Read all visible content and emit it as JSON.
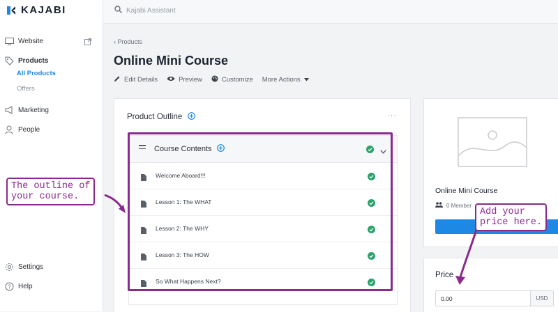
{
  "app": {
    "logo_text": "KAJABI"
  },
  "search": {
    "placeholder": "Kajabi Assistant"
  },
  "sidebar": {
    "items": [
      {
        "label": "Website",
        "icon": "monitor-icon"
      },
      {
        "label": "Products",
        "icon": "tag-icon"
      },
      {
        "label": "All Products"
      },
      {
        "label": "Offers"
      },
      {
        "label": "Marketing",
        "icon": "megaphone-icon"
      },
      {
        "label": "People",
        "icon": "person-icon"
      },
      {
        "label": "Settings",
        "icon": "gear-icon"
      },
      {
        "label": "Help",
        "icon": "help-icon"
      }
    ]
  },
  "header": {
    "breadcrumb": "Products",
    "title": "Online Mini Course",
    "actions": [
      {
        "label": "Edit Details",
        "icon": "pencil-icon"
      },
      {
        "label": "Preview",
        "icon": "eye-icon"
      },
      {
        "label": "Customize",
        "icon": "palette-icon"
      },
      {
        "label": "More Actions",
        "icon": "caret-down-icon"
      }
    ]
  },
  "outline": {
    "title": "Product Outline",
    "more_label": "···",
    "category": {
      "title": "Course Contents"
    },
    "lessons": [
      {
        "label": "Welcome Aboard!!!"
      },
      {
        "label": "Lesson 1: The WHAT"
      },
      {
        "label": "Lesson 2: The WHY"
      },
      {
        "label": "Lesson 3: The HOW"
      },
      {
        "label": "So What Happens Next?"
      }
    ]
  },
  "product_card": {
    "title": "Online Mini Course",
    "members": "0 Member"
  },
  "price": {
    "label": "Price",
    "value": "0.00",
    "currency": "USD"
  },
  "annotations": {
    "outline_note": "The outline of\nyour course.",
    "price_note": "Add your\nprice here."
  },
  "colors": {
    "accent": "#1e88e5",
    "check": "#29a36a",
    "annotation": "#8a2a8e"
  }
}
